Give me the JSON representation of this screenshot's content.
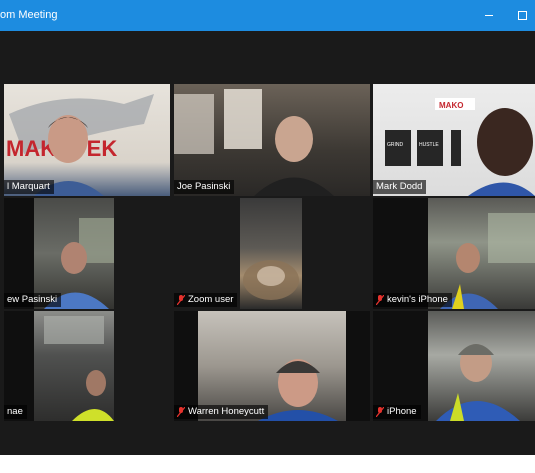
{
  "window": {
    "title": "om Meeting",
    "accent": "#1d8ce0",
    "active_speaker_color": "#c9f55a"
  },
  "tiles": [
    {
      "name": "l Marquart",
      "muted": false,
      "backdrop_logo": "MAKOTEK"
    },
    {
      "name": "Joe Pasinski",
      "muted": false,
      "active": true
    },
    {
      "name": "Mark Dodd",
      "muted": false,
      "posters": [
        "GRIND",
        "HUSTLE"
      ],
      "banner_logo": "MAKO"
    },
    {
      "name": "ew Pasinski",
      "muted": false
    },
    {
      "name": "Zoom user",
      "muted": true
    },
    {
      "name": "kevin's iPhone",
      "muted": true
    },
    {
      "name": "nae",
      "muted": false
    },
    {
      "name": "Warren Honeycutt",
      "muted": true
    },
    {
      "name": "iPhone",
      "muted": true
    }
  ]
}
